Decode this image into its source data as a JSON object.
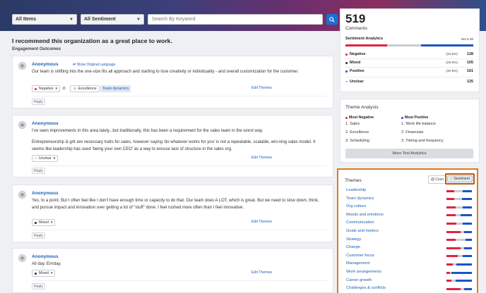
{
  "filters": {
    "items": "All Items",
    "sentiment": "All Sentiment",
    "search_placeholder": "Search By Keyword"
  },
  "question": "I recommend this organization as a great place to work.",
  "subtitle": "Engagement Outcomes",
  "comments": [
    {
      "author": "Anonymous",
      "show_language": "Show Original Language",
      "text": "Our team is shifting into the one-size fits all approach and starting to lose creativity or individuality - and overall customization for the customer.",
      "sentiment": "Negative",
      "tags": [
        "Excellence",
        "Team dynamics"
      ],
      "edit": "Edit Themes",
      "reply": "Reply"
    },
    {
      "author": "Anonymous",
      "text1": "I've seen improvements in this area lately...but traditionally, this has been a requirement for the sales team in the worst way.",
      "text2": "Entrepreneurship & grit are necessary traits for sales, however saying 'do whatever works for you' is not a repeatable, scalable, win-ning sales model. It seems like leadership has used 'being your own CEO' as a way to excuse lack of structure in the sales org.",
      "sentiment": "Unclear",
      "edit": "Edit Themes",
      "reply": "Reply"
    },
    {
      "author": "Anonymous",
      "text": "Yes, to a point. But I often feel like I don't have enough time or capacity to do that. Our team does A LOT, which is great. But we need to slow down, think, and pursue impact and innovation over getting a lot of \"stuff\" done. I feel rushed more often than I feel innovative.",
      "sentiment": "Mixed",
      "edit": "Edit Themes",
      "reply": "Reply"
    },
    {
      "author": "Anonymous",
      "text": "All day. Errrday.",
      "sentiment": "Mixed",
      "edit": "Edit Themes",
      "reply": "Reply"
    }
  ],
  "summary": {
    "count": "519",
    "count_label": "Comments",
    "analytics_title": "Sentiment Analytics",
    "net": "Net 8.38",
    "rows": [
      {
        "label": "Negative",
        "pct": "(32.5%)",
        "num": "128",
        "color": "#e0243f"
      },
      {
        "label": "Mixed",
        "pct": "(26.6%)",
        "num": "105",
        "color": "#1f2a44"
      },
      {
        "label": "Positive",
        "pct": "(40.9%)",
        "num": "161",
        "color": "#1b55c4"
      },
      {
        "label": "Unclear",
        "pct": "",
        "num": "125",
        "color": ""
      }
    ]
  },
  "theme_analysis": {
    "title": "Theme Analysis",
    "neg_head": "Most Negative",
    "pos_head": "Most Positive",
    "negative": [
      "1. Sales",
      "2. Excellence",
      "3. Scheduling"
    ],
    "positive": [
      "1. Work life balance",
      "2. Financials",
      "3. Timing and frequency"
    ],
    "button": "More Text Analytics"
  },
  "themes": {
    "title": "Themes",
    "count_btn": "Coun",
    "sentiment_btn": "Sentiment",
    "items": [
      {
        "name": "Leadership",
        "neg": 0.3,
        "mix": 0.35,
        "pos": 0.35
      },
      {
        "name": "Team dynamics",
        "neg": 0.3,
        "mix": 0.3,
        "pos": 0.4
      },
      {
        "name": "Org culture",
        "neg": 0.35,
        "mix": 0.3,
        "pos": 0.35
      },
      {
        "name": "Moods and emotions",
        "neg": 0.35,
        "mix": 0.2,
        "pos": 0.45
      },
      {
        "name": "Communication",
        "neg": 0.4,
        "mix": 0.25,
        "pos": 0.35
      },
      {
        "name": "Goals and metrics",
        "neg": 0.55,
        "mix": 0.15,
        "pos": 0.3
      },
      {
        "name": "Strategy",
        "neg": 0.35,
        "mix": 0.4,
        "pos": 0.25
      },
      {
        "name": "Change",
        "neg": 0.55,
        "mix": 0.15,
        "pos": 0.3
      },
      {
        "name": "Customer focus",
        "neg": 0.45,
        "mix": 0.2,
        "pos": 0.35
      },
      {
        "name": "Management",
        "neg": 0.25,
        "mix": 0.15,
        "pos": 0.6
      },
      {
        "name": "Work arrangements",
        "neg": 0.15,
        "mix": 0.05,
        "pos": 0.8
      },
      {
        "name": "Career growth",
        "neg": 0.2,
        "mix": 0.15,
        "pos": 0.65
      },
      {
        "name": "Challenges & conflicts",
        "neg": 0.55,
        "mix": 0.15,
        "pos": 0.3
      }
    ]
  }
}
